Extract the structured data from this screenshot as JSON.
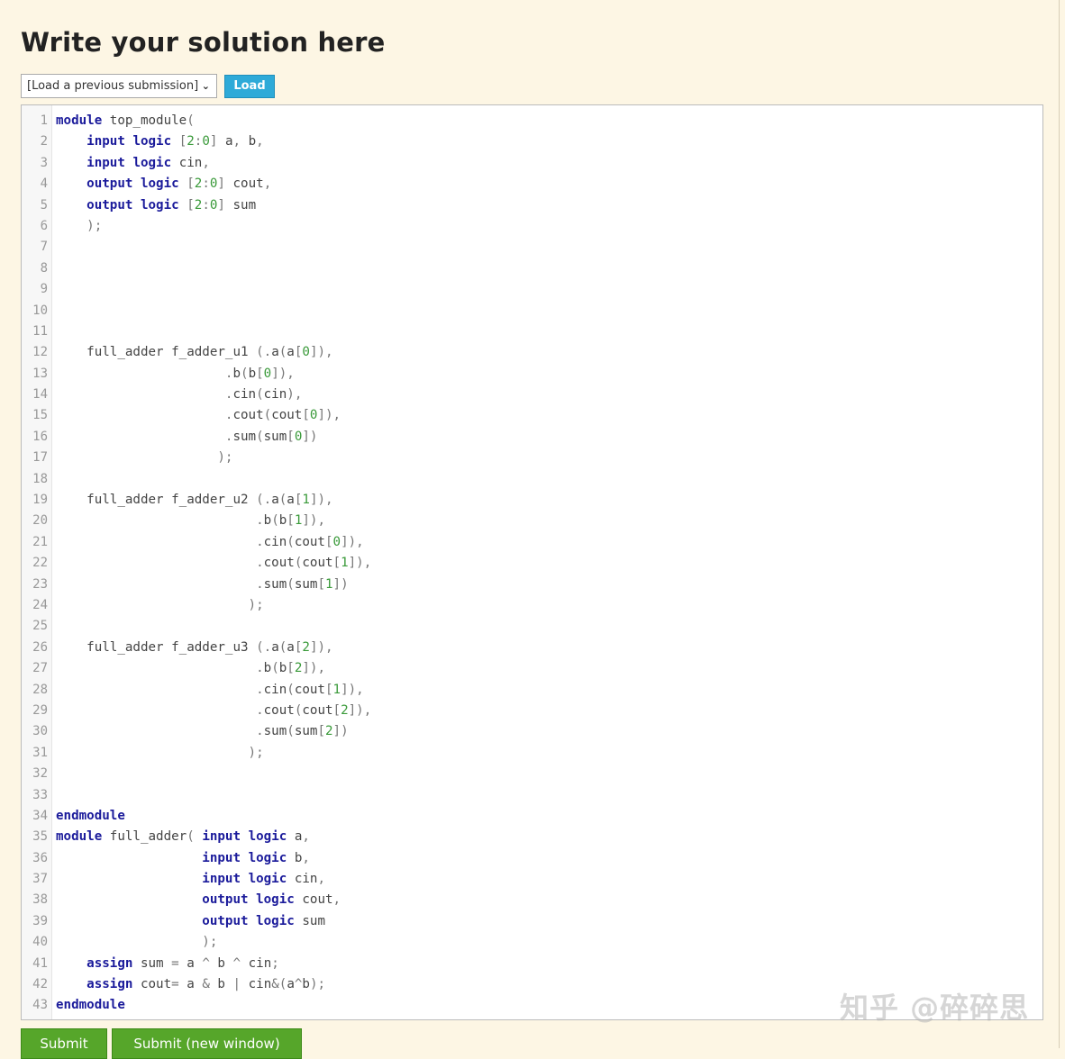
{
  "heading": "Write your solution here",
  "submission_select": {
    "selected": "[Load a previous submission]"
  },
  "load_button": "Load",
  "submit_button": "Submit",
  "submit_new_window_button": "Submit (new window)",
  "watermark": "知乎 @碎碎思",
  "colors": {
    "keyword": "#1b1b9b",
    "number": "#3a9a3a",
    "load_button": "#2eaad8",
    "submit_button": "#56a62a",
    "background": "#fdf6e4"
  },
  "code_lines": [
    "module top_module(",
    "    input logic [2:0] a, b,",
    "    input logic cin,",
    "    output logic [2:0] cout,",
    "    output logic [2:0] sum",
    "    );",
    "",
    "",
    "",
    "",
    "",
    "    full_adder f_adder_u1 (.a(a[0]),",
    "                      .b(b[0]),",
    "                      .cin(cin),",
    "                      .cout(cout[0]),",
    "                      .sum(sum[0])",
    "                     );",
    "",
    "    full_adder f_adder_u2 (.a(a[1]),",
    "                          .b(b[1]),",
    "                          .cin(cout[0]),",
    "                          .cout(cout[1]),",
    "                          .sum(sum[1])",
    "                         );",
    "",
    "    full_adder f_adder_u3 (.a(a[2]),",
    "                          .b(b[2]),",
    "                          .cin(cout[1]),",
    "                          .cout(cout[2]),",
    "                          .sum(sum[2])",
    "                         );",
    "",
    "",
    "endmodule",
    "module full_adder( input logic a,",
    "                   input logic b,",
    "                   input logic cin,",
    "                   output logic cout,",
    "                   output logic sum",
    "                   );",
    "    assign sum = a ^ b ^ cin;",
    "    assign cout= a & b | cin&(a^b);",
    "endmodule"
  ]
}
